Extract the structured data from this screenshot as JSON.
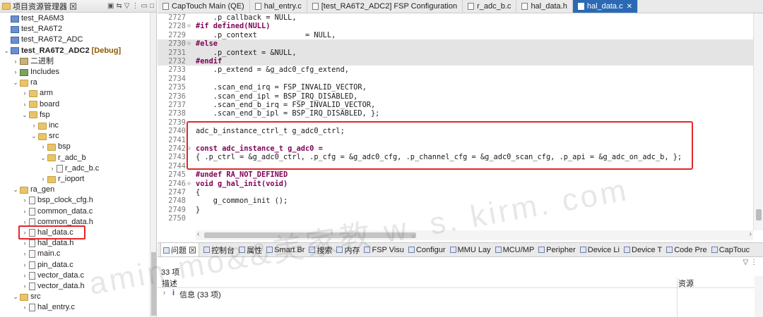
{
  "explorer": {
    "title": "项目资源管理器 ⊠",
    "items": [
      {
        "label": "test_RA6M3",
        "indent": 0,
        "arrow": "",
        "icon": "proj"
      },
      {
        "label": "test_RA6T2",
        "indent": 0,
        "arrow": "",
        "icon": "proj"
      },
      {
        "label": "test_RA6T2_ADC",
        "indent": 0,
        "arrow": "",
        "icon": "proj"
      },
      {
        "label": "test_RA6T2_ADC2",
        "suffix": "[Debug]",
        "indent": 0,
        "arrow": "⌄",
        "icon": "proj",
        "bold": true
      },
      {
        "label": "二进制",
        "indent": 1,
        "arrow": "›",
        "icon": "bin"
      },
      {
        "label": "Includes",
        "indent": 1,
        "arrow": "›",
        "icon": "lib"
      },
      {
        "label": "ra",
        "indent": 1,
        "arrow": "⌄",
        "icon": "folder"
      },
      {
        "label": "arm",
        "indent": 2,
        "arrow": "›",
        "icon": "folder"
      },
      {
        "label": "board",
        "indent": 2,
        "arrow": "›",
        "icon": "folder"
      },
      {
        "label": "fsp",
        "indent": 2,
        "arrow": "⌄",
        "icon": "folder"
      },
      {
        "label": "inc",
        "indent": 3,
        "arrow": "›",
        "icon": "folder"
      },
      {
        "label": "src",
        "indent": 3,
        "arrow": "⌄",
        "icon": "folder"
      },
      {
        "label": "bsp",
        "indent": 4,
        "arrow": "›",
        "icon": "folder"
      },
      {
        "label": "r_adc_b",
        "indent": 4,
        "arrow": "⌄",
        "icon": "folder"
      },
      {
        "label": "r_adc_b.c",
        "indent": 5,
        "arrow": "›",
        "icon": "file"
      },
      {
        "label": "r_ioport",
        "indent": 4,
        "arrow": "›",
        "icon": "folder"
      },
      {
        "label": "ra_gen",
        "indent": 1,
        "arrow": "⌄",
        "icon": "folder"
      },
      {
        "label": "bsp_clock_cfg.h",
        "indent": 2,
        "arrow": "›",
        "icon": "file"
      },
      {
        "label": "common_data.c",
        "indent": 2,
        "arrow": "›",
        "icon": "file"
      },
      {
        "label": "common_data.h",
        "indent": 2,
        "arrow": "›",
        "icon": "file"
      },
      {
        "label": "hal_data.c",
        "indent": 2,
        "arrow": "›",
        "icon": "file"
      },
      {
        "label": "hal_data.h",
        "indent": 2,
        "arrow": "›",
        "icon": "file"
      },
      {
        "label": "main.c",
        "indent": 2,
        "arrow": "›",
        "icon": "file"
      },
      {
        "label": "pin_data.c",
        "indent": 2,
        "arrow": "›",
        "icon": "file"
      },
      {
        "label": "vector_data.c",
        "indent": 2,
        "arrow": "›",
        "icon": "file"
      },
      {
        "label": "vector_data.h",
        "indent": 2,
        "arrow": "›",
        "icon": "file"
      },
      {
        "label": "src",
        "indent": 1,
        "arrow": "⌄",
        "icon": "folder"
      },
      {
        "label": "hal_entry.c",
        "indent": 2,
        "arrow": "›",
        "icon": "file"
      }
    ]
  },
  "tabs": [
    {
      "label": "CapTouch Main (QE)",
      "active": false
    },
    {
      "label": "hal_entry.c",
      "active": false
    },
    {
      "label": "[test_RA6T2_ADC2] FSP Configuration",
      "active": false
    },
    {
      "label": "r_adc_b.c",
      "active": false
    },
    {
      "label": "hal_data.h",
      "active": false
    },
    {
      "label": "hal_data.c",
      "active": true
    }
  ],
  "code": [
    {
      "n": "2727",
      "t": "    .p_callback = NULL,",
      "grey": false
    },
    {
      "n": "2728",
      "t": "#if defined(NULL)",
      "grey": false,
      "fold": "⊖"
    },
    {
      "n": "2729",
      "t": "    .p_context           = NULL,",
      "grey": false
    },
    {
      "n": "2730",
      "t": "#else",
      "grey": true,
      "fold": "⊖"
    },
    {
      "n": "2731",
      "t": "    .p_context = &NULL,",
      "grey": true
    },
    {
      "n": "2732",
      "t": "#endif",
      "grey": true
    },
    {
      "n": "2733",
      "t": "    .p_extend = &g_adc0_cfg_extend,",
      "grey": false
    },
    {
      "n": "2734",
      "t": "",
      "grey": false
    },
    {
      "n": "2735",
      "t": "    .scan_end_irq = FSP_INVALID_VECTOR,",
      "grey": false
    },
    {
      "n": "2736",
      "t": "    .scan_end_ipl = BSP_IRQ_DISABLED,",
      "grey": false
    },
    {
      "n": "2737",
      "t": "    .scan_end_b_irq = FSP_INVALID_VECTOR,",
      "grey": false
    },
    {
      "n": "2738",
      "t": "    .scan_end_b_ipl = BSP_IRQ_DISABLED, };",
      "grey": false
    },
    {
      "n": "2739",
      "t": "",
      "grey": false
    },
    {
      "n": "2740",
      "t": "adc_b_instance_ctrl_t g_adc0_ctrl;",
      "grey": false
    },
    {
      "n": "2741",
      "t": "",
      "grey": false
    },
    {
      "n": "2742",
      "t": "const adc_instance_t g_adc0 =",
      "grey": false,
      "fold": "⊖"
    },
    {
      "n": "2743",
      "t": "{ .p_ctrl = &g_adc0_ctrl, .p_cfg = &g_adc0_cfg, .p_channel_cfg = &g_adc0_scan_cfg, .p_api = &g_adc_on_adc_b, };",
      "grey": false
    },
    {
      "n": "2744",
      "t": "",
      "grey": false
    },
    {
      "n": "2745",
      "t": "#undef RA_NOT_DEFINED",
      "grey": false
    },
    {
      "n": "2746",
      "t": "void g_hal_init(void)",
      "grey": false,
      "fold": "⊖"
    },
    {
      "n": "2747",
      "t": "{",
      "grey": false
    },
    {
      "n": "2748",
      "t": "    g_common_init ();",
      "grey": false
    },
    {
      "n": "2749",
      "t": "}",
      "grey": false
    },
    {
      "n": "2750",
      "t": "",
      "grey": false
    }
  ],
  "bottom": {
    "tabs": [
      "问题 ⊠",
      "控制台",
      "属性",
      "Smart Br",
      "搜索",
      "内存",
      "FSP Visu",
      "Configur",
      "MMU Lay",
      "MCU/MP",
      "Peripher",
      "Device Li",
      "Device T",
      "Code Pre",
      "CapTouc"
    ],
    "count": "33 项",
    "col_desc": "描述",
    "col_resource": "资源",
    "row_arrow": "›",
    "row_icon": "i",
    "row_text": "信息 (33 项)"
  },
  "watermark": "amin mo&&美家教  w. s. kirm. com",
  "colors": {
    "accent": "#2a6ab4",
    "highlight_border": "#e3262a",
    "inactive_code_bg": "#e4e4e4",
    "keyword": "#7f0055"
  }
}
